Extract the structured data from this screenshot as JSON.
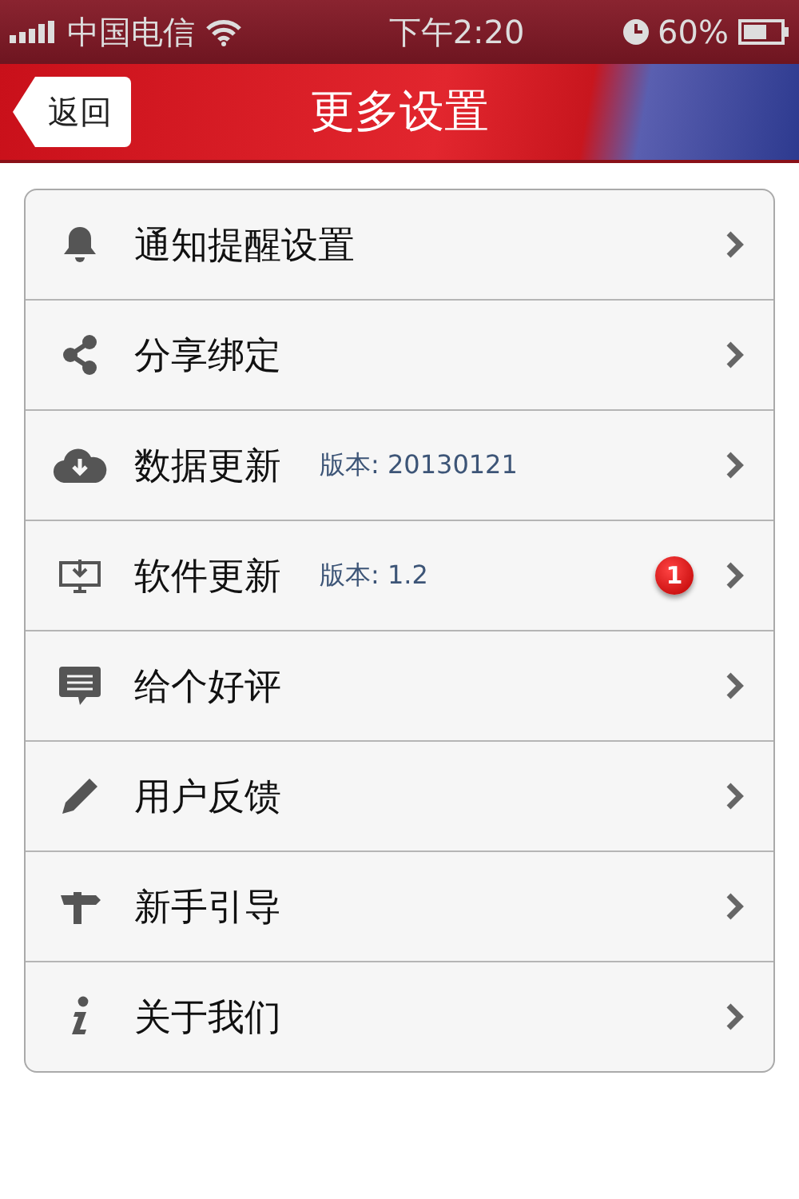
{
  "status_bar": {
    "carrier": "中国电信",
    "time": "下午2:20",
    "battery": "60%"
  },
  "nav": {
    "back": "返回",
    "title": "更多设置"
  },
  "items": [
    {
      "label": "通知提醒设置"
    },
    {
      "label": "分享绑定"
    },
    {
      "label": "数据更新",
      "version": "版本: 20130121"
    },
    {
      "label": "软件更新",
      "version": "版本: 1.2",
      "badge": "1"
    },
    {
      "label": "给个好评"
    },
    {
      "label": "用户反馈"
    },
    {
      "label": "新手引导"
    },
    {
      "label": "关于我们"
    }
  ]
}
